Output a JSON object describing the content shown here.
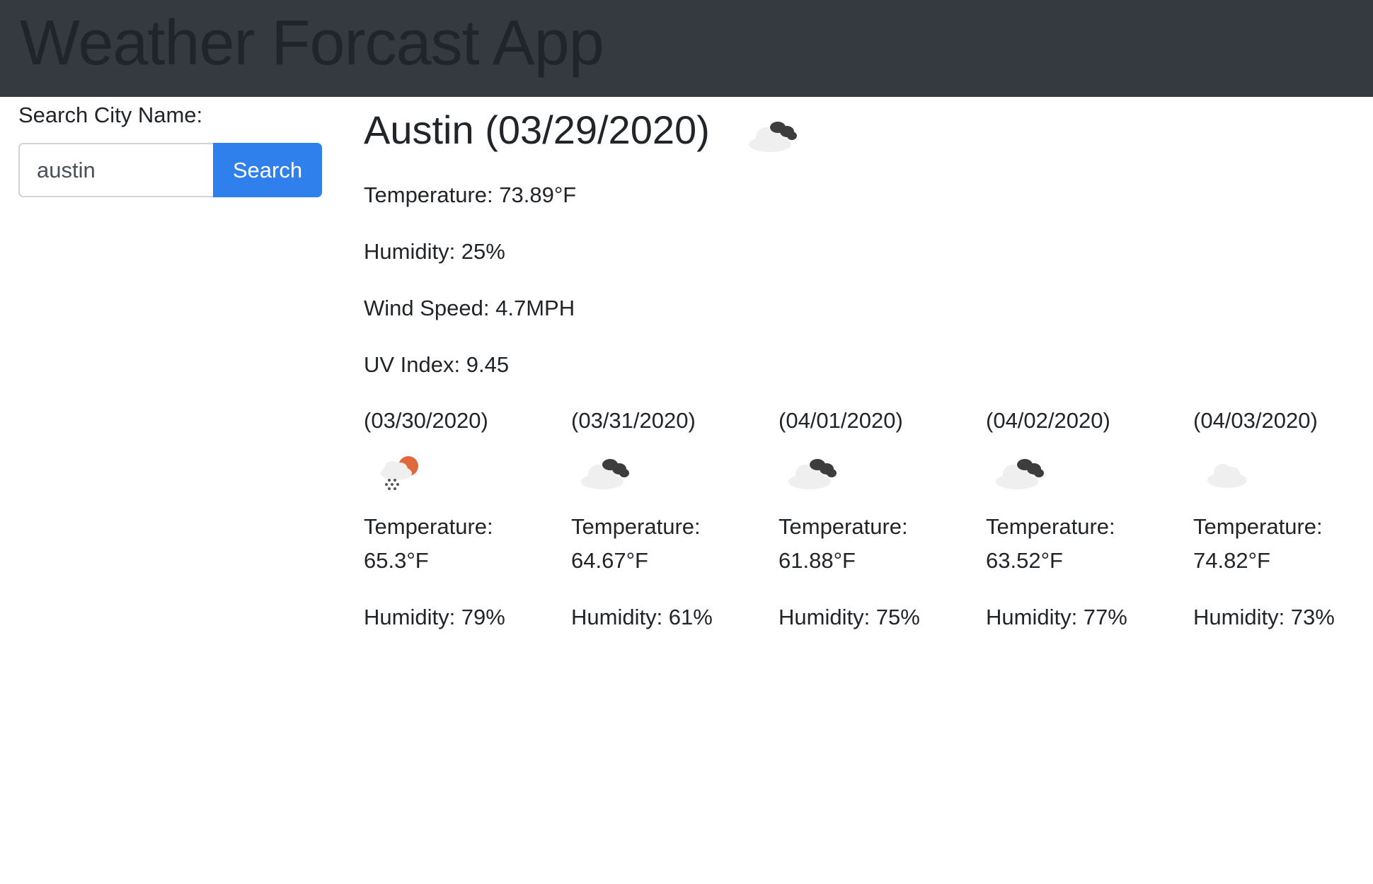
{
  "header": {
    "title": "Weather Forcast App",
    "bg_color": "#343a40"
  },
  "search": {
    "label": "Search City Name:",
    "value": "austin",
    "button_label": "Search",
    "button_color": "#2f80ed"
  },
  "current": {
    "title": "Austin (03/29/2020)",
    "icon": "broken-clouds-icon",
    "temperature": "Temperature: 73.89°F",
    "humidity": "Humidity: 25%",
    "wind": "Wind Speed: 4.7MPH",
    "uv": "UV Index: 9.45"
  },
  "forecast": [
    {
      "date": "(03/30/2020)",
      "icon": "rain-sun-icon",
      "temp_label": "Temperature:",
      "temp": "65.3°F",
      "humidity": "Humidity: 79%"
    },
    {
      "date": "(03/31/2020)",
      "icon": "broken-clouds-icon",
      "temp_label": "Temperature:",
      "temp": "64.67°F",
      "humidity": "Humidity: 61%"
    },
    {
      "date": "(04/01/2020)",
      "icon": "broken-clouds-icon",
      "temp_label": "Temperature:",
      "temp": "61.88°F",
      "humidity": "Humidity: 75%"
    },
    {
      "date": "(04/02/2020)",
      "icon": "broken-clouds-icon",
      "temp_label": "Temperature:",
      "temp": "63.52°F",
      "humidity": "Humidity: 77%"
    },
    {
      "date": "(04/03/2020)",
      "icon": "cloud-icon",
      "temp_label": "Temperature:",
      "temp": "74.82°F",
      "humidity": "Humidity: 73%"
    }
  ]
}
